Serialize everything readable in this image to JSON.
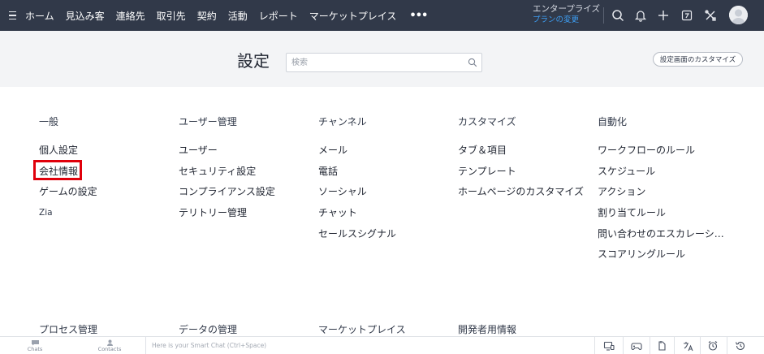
{
  "topbar": {
    "nav": [
      "ホーム",
      "見込み客",
      "連絡先",
      "取引先",
      "契約",
      "活動",
      "レポート",
      "マーケットプレイス"
    ],
    "more_label": "•••",
    "plan_name": "エンタープライズ",
    "plan_link": "プランの変更",
    "icons": [
      "search-icon",
      "bell-icon",
      "plus-icon",
      "calendar-icon",
      "tools-icon",
      "user-avatar"
    ]
  },
  "header": {
    "title": "設定",
    "search_placeholder": "検索",
    "customize_label": "設定画面のカスタマイズ"
  },
  "columns": [
    {
      "title": "一般",
      "items": [
        "個人設定",
        "会社情報",
        "ゲームの設定",
        "Zia"
      ]
    },
    {
      "title": "ユーザー管理",
      "items": [
        "ユーザー",
        "セキュリティ設定",
        "コンプライアンス設定",
        "テリトリー管理"
      ]
    },
    {
      "title": "チャンネル",
      "items": [
        "メール",
        "電話",
        "ソーシャル",
        "チャット",
        "セールスシグナル"
      ]
    },
    {
      "title": "カスタマイズ",
      "items": [
        "タブ＆項目",
        "テンプレート",
        "ホームページのカスタマイズ"
      ]
    },
    {
      "title": "自動化",
      "items": [
        "ワークフローのルール",
        "スケジュール",
        "アクション",
        "割り当てルール",
        "問い合わせのエスカレーシ…",
        "スコアリングルール"
      ]
    }
  ],
  "bottom_sections": [
    "プロセス管理",
    "データの管理",
    "マーケットプレイス",
    "開発者用情報"
  ],
  "bottombar": {
    "chats_label": "Chats",
    "contacts_label": "Contacts",
    "smartchat_placeholder": "Here is your Smart Chat (Ctrl+Space)"
  },
  "colors": {
    "topbar_bg": "#313949",
    "header_bg": "#f3f4f6",
    "highlight": "#e0000b",
    "link": "#3d9df2"
  }
}
